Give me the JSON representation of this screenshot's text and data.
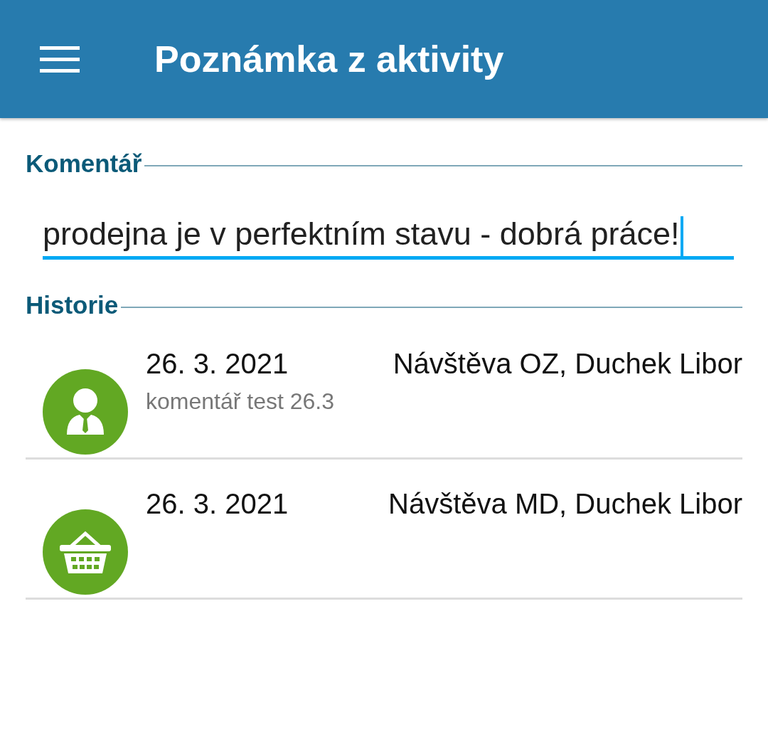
{
  "app_bar": {
    "title": "Poznámka z aktivity"
  },
  "comment": {
    "label": "Komentář",
    "value": "prodejna je v perfektním stavu - dobrá práce!",
    "focused": true
  },
  "history": {
    "label": "Historie",
    "items": [
      {
        "kind": "person",
        "date": "26. 3. 2021",
        "title": "Návštěva OZ, Duchek Libor",
        "note": "komentář test 26.3"
      },
      {
        "kind": "basket",
        "date": "26. 3. 2021",
        "title": "Návštěva MD, Duchek Libor"
      }
    ]
  }
}
